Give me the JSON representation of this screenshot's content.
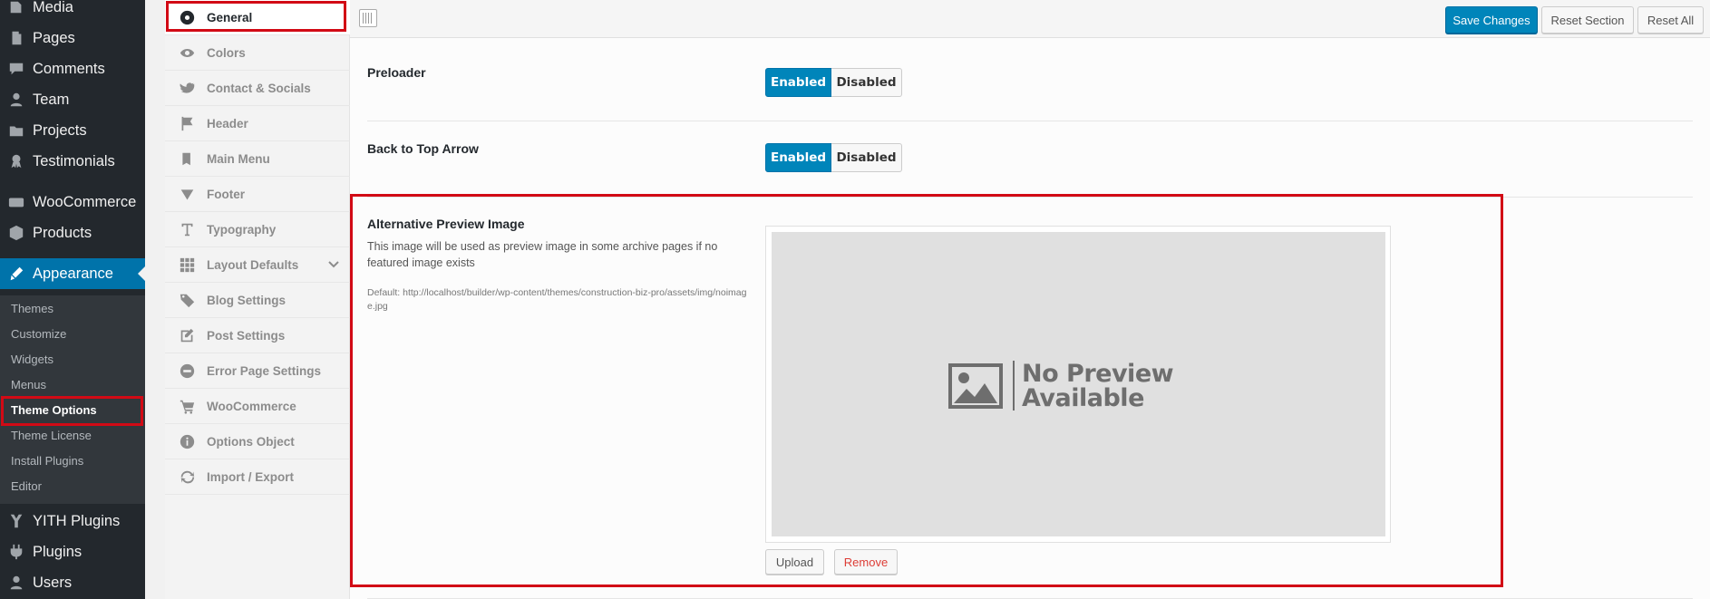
{
  "admin_menu": {
    "items": [
      {
        "label": "Media",
        "icon": "media-icon"
      },
      {
        "label": "Pages",
        "icon": "pages-icon"
      },
      {
        "label": "Comments",
        "icon": "comments-icon"
      },
      {
        "label": "Team",
        "icon": "team-icon"
      },
      {
        "label": "Projects",
        "icon": "projects-icon"
      },
      {
        "label": "Testimonials",
        "icon": "testimonials-icon"
      },
      {
        "label": "WooCommerce",
        "icon": "woocommerce-icon"
      },
      {
        "label": "Products",
        "icon": "products-icon"
      },
      {
        "label": "Appearance",
        "icon": "appearance-icon"
      },
      {
        "label": "YITH Plugins",
        "icon": "yith-icon"
      },
      {
        "label": "Plugins",
        "icon": "plugins-icon"
      },
      {
        "label": "Users",
        "icon": "users-icon"
      }
    ],
    "submenu": [
      "Themes",
      "Customize",
      "Widgets",
      "Menus",
      "Theme Options",
      "Theme License",
      "Install Plugins",
      "Editor"
    ],
    "woo_badge": "woo"
  },
  "options_sidebar": {
    "items": [
      {
        "label": "General",
        "icon": "general-icon"
      },
      {
        "label": "Colors",
        "icon": "eye-icon"
      },
      {
        "label": "Contact & Socials",
        "icon": "twitter-icon"
      },
      {
        "label": "Header",
        "icon": "flag-icon"
      },
      {
        "label": "Main Menu",
        "icon": "book-icon"
      },
      {
        "label": "Footer",
        "icon": "triangle-down-icon"
      },
      {
        "label": "Typography",
        "icon": "text-icon"
      },
      {
        "label": "Layout Defaults",
        "icon": "grid-icon"
      },
      {
        "label": "Blog Settings",
        "icon": "tag-icon"
      },
      {
        "label": "Post Settings",
        "icon": "edit-icon"
      },
      {
        "label": "Error Page Settings",
        "icon": "minus-circle-icon"
      },
      {
        "label": "WooCommerce",
        "icon": "cart-icon"
      },
      {
        "label": "Options Object",
        "icon": "info-icon"
      },
      {
        "label": "Import / Export",
        "icon": "refresh-icon"
      }
    ]
  },
  "toolbar": {
    "save": "Save Changes",
    "reset_section": "Reset Section",
    "reset_all": "Reset All"
  },
  "options": {
    "preloader": {
      "label": "Preloader",
      "on": "Enabled",
      "off": "Disabled"
    },
    "back_to_top": {
      "label": "Back to Top Arrow",
      "on": "Enabled",
      "off": "Disabled"
    },
    "preview_image": {
      "label": "Alternative Preview Image",
      "desc": "This image will be used as preview image in some archive pages if no featured image exists",
      "default": "Default: http://localhost/builder/wp-content/themes/construction-biz-pro/assets/img/noimage.jpg",
      "placeholder_line1": "No Preview",
      "placeholder_line2": "Available",
      "upload": "Upload",
      "remove": "Remove"
    }
  },
  "colors": {
    "admin_bg": "#23282d",
    "accent": "#0073aa",
    "highlight": "#d20a15"
  }
}
